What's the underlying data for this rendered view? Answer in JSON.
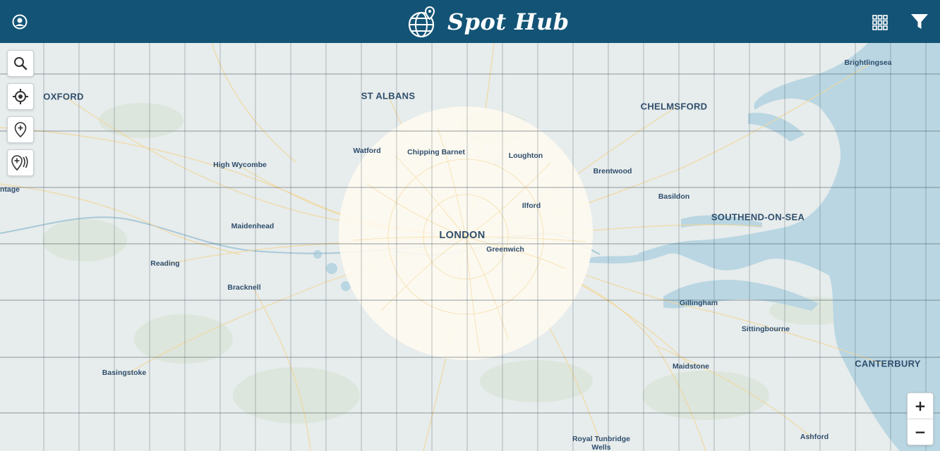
{
  "app": {
    "title": "Spot Hub"
  },
  "header": {
    "user_icon": "user-circle-icon",
    "logo_icon": "globe-pin-icon",
    "grid_icon": "grid-icon",
    "filter_icon": "filter-icon",
    "background_color": "#135476"
  },
  "map_tools": [
    {
      "name": "search",
      "icon": "search-icon"
    },
    {
      "name": "locate",
      "icon": "crosshair-icon"
    },
    {
      "name": "add-spot",
      "icon": "pin-plus-icon"
    },
    {
      "name": "add-spot-radius",
      "icon": "pin-signal-icon"
    }
  ],
  "zoom": {
    "in_label": "+",
    "out_label": "−"
  },
  "highlight": {
    "center": "LONDON",
    "color": "#fffaf0"
  },
  "colors": {
    "land": "#e7ecec",
    "water": "#b9d6e2",
    "roads": "#f2d79b",
    "grid": "#3a4a55",
    "labels": "#2f4e6d"
  },
  "labels": {
    "oxford": "OXFORD",
    "st_albans": "ST ALBANS",
    "chelmsford": "CHELMSFORD",
    "brightlingsea": "Brightlingsea",
    "watford": "Watford",
    "chipping_barnet": "Chipping Barnet",
    "loughton": "Loughton",
    "high_wycombe": "High Wycombe",
    "brentwood": "Brentwood",
    "ntage": "ntage",
    "basildon": "Basildon",
    "ilford": "Ilford",
    "southend": "SOUTHEND-ON-SEA",
    "maidenhead": "Maidenhead",
    "london": "LONDON",
    "greenwich": "Greenwich",
    "reading": "Reading",
    "bracknell": "Bracknell",
    "gillingham": "Gillingham",
    "sittingbourne": "Sittingbourne",
    "basingstoke": "Basingstoke",
    "maidstone": "Maidstone",
    "canterbury": "CANTERBURY",
    "royal_tunbridge_wells": "Royal Tunbridge Wells",
    "ashford": "Ashford"
  }
}
